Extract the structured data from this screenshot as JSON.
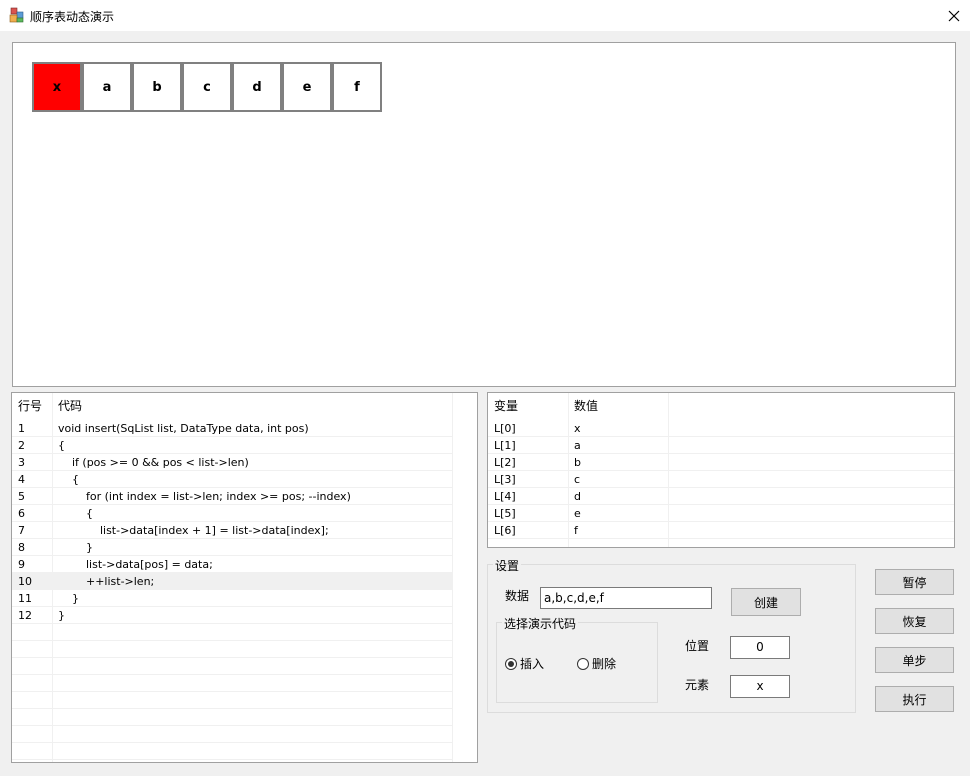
{
  "window": {
    "title": "顺序表动态演示"
  },
  "canvas": {
    "cells": [
      {
        "value": "x",
        "highlight": true
      },
      {
        "value": "a",
        "highlight": false
      },
      {
        "value": "b",
        "highlight": false
      },
      {
        "value": "c",
        "highlight": false
      },
      {
        "value": "d",
        "highlight": false
      },
      {
        "value": "e",
        "highlight": false
      },
      {
        "value": "f",
        "highlight": false
      }
    ],
    "highlight_color": "#ff0000"
  },
  "code": {
    "headers": [
      "行号",
      "代码"
    ],
    "selected_line": "10",
    "rows": [
      {
        "line": "1",
        "code": "void insert(SqList list, DataType data, int pos)"
      },
      {
        "line": "2",
        "code": "{"
      },
      {
        "line": "3",
        "code": "    if (pos >= 0 && pos < list->len)"
      },
      {
        "line": "4",
        "code": "    {"
      },
      {
        "line": "5",
        "code": "        for (int index = list->len; index >= pos; --index)"
      },
      {
        "line": "6",
        "code": "        {"
      },
      {
        "line": "7",
        "code": "            list->data[index + 1] = list->data[index];"
      },
      {
        "line": "8",
        "code": "        }"
      },
      {
        "line": "9",
        "code": "        list->data[pos] = data;"
      },
      {
        "line": "10",
        "code": "        ++list->len;"
      },
      {
        "line": "11",
        "code": "    }"
      },
      {
        "line": "12",
        "code": "}"
      }
    ]
  },
  "variables": {
    "headers": [
      "变量",
      "数值"
    ],
    "rows": [
      {
        "name": "L[0]",
        "value": "x"
      },
      {
        "name": "L[1]",
        "value": "a"
      },
      {
        "name": "L[2]",
        "value": "b"
      },
      {
        "name": "L[3]",
        "value": "c"
      },
      {
        "name": "L[4]",
        "value": "d"
      },
      {
        "name": "L[5]",
        "value": "e"
      },
      {
        "name": "L[6]",
        "value": "f"
      }
    ]
  },
  "settings": {
    "title": "设置",
    "data_label": "数据",
    "data_value": "a,b,c,d,e,f",
    "create_label": "创建",
    "mode_title": "选择演示代码",
    "insert_label": "插入",
    "delete_label": "删除",
    "selected_mode": "insert",
    "position_label": "位置",
    "position_value": "0",
    "element_label": "元素",
    "element_value": "x"
  },
  "controls": {
    "pause": "暂停",
    "resume": "恢复",
    "step": "单步",
    "run": "执行"
  }
}
